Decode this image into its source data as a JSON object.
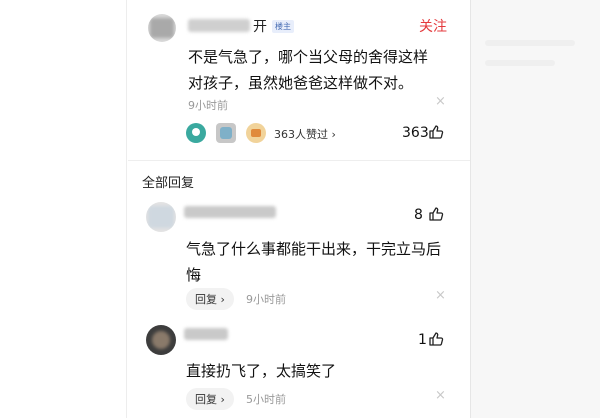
{
  "main_comment": {
    "author_suffix": "开",
    "badge": "楼主",
    "follow_label": "关注",
    "content": "不是气急了，哪个当父母的舍得这样对孩子，虽然她爸爸这样做不对。",
    "time": "9小时前",
    "likers_text": "363人赞过 ›",
    "like_count": "363",
    "close_icon": "×"
  },
  "replies_section": {
    "title": "全部回复"
  },
  "replies": [
    {
      "content": "气急了什么事都能干出来，干完立马后悔",
      "like_count": "8",
      "reply_label": "回复 ›",
      "time": "9小时前",
      "close_icon": "×"
    },
    {
      "content": "直接扔飞了，太搞笑了",
      "like_count": "1",
      "reply_label": "回复 ›",
      "time": "5小时前",
      "close_icon": "×"
    }
  ],
  "icons": {
    "like": "thumbs-up-icon",
    "close": "close-icon"
  },
  "colors": {
    "follow": "#e4393c",
    "badge_text": "#4a6fb5",
    "badge_bg": "#e8eefb",
    "meta_gray": "#999999"
  }
}
